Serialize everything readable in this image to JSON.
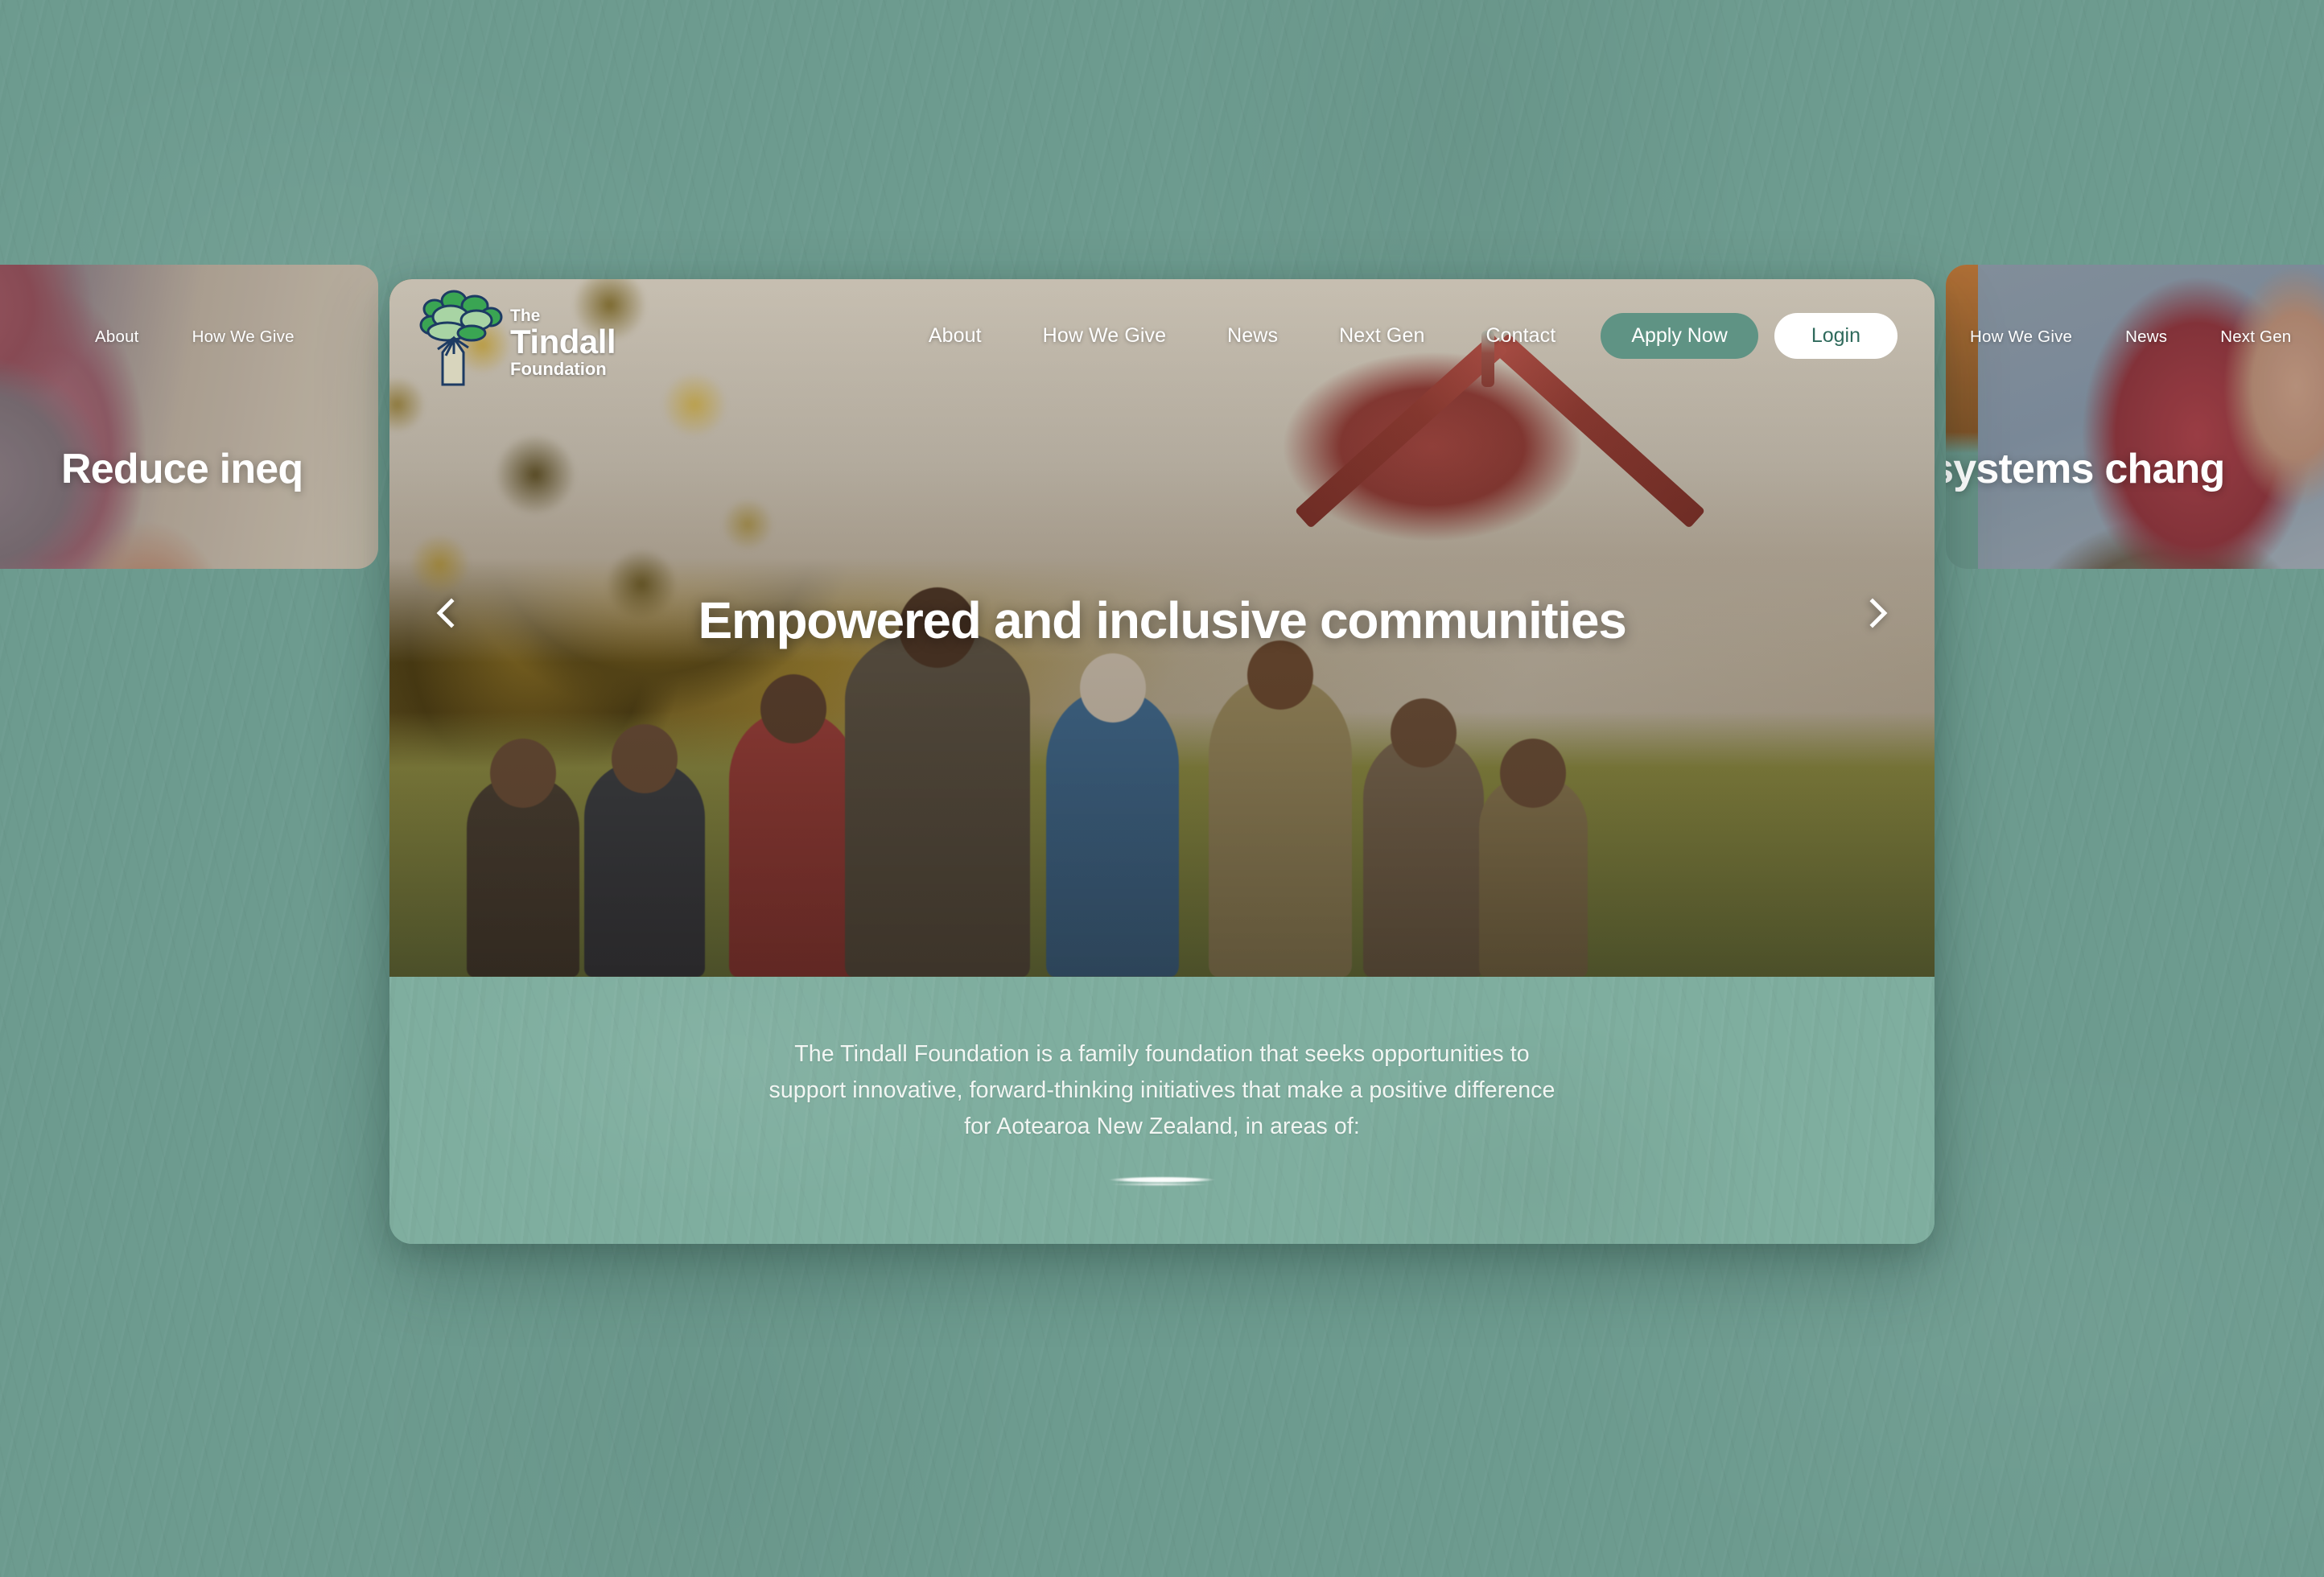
{
  "site": {
    "logo": {
      "line1": "The",
      "line2": "Tindall",
      "line3": "Foundation",
      "icon": "tree-logo-icon"
    },
    "accent_green": "#5f9384",
    "panel_green": "#7fae9f",
    "page_green": "#6d9b8f"
  },
  "nav": {
    "links": [
      {
        "label": "About"
      },
      {
        "label": "How We Give"
      },
      {
        "label": "News"
      },
      {
        "label": "Next Gen"
      },
      {
        "label": "Contact"
      }
    ],
    "apply_label": "Apply Now",
    "login_label": "Login"
  },
  "hero": {
    "title": "Empowered and inclusive communities",
    "prev_icon": "chevron-left-icon",
    "next_icon": "chevron-right-icon",
    "image_alt": "People sharing a meal outside a carved wharenui at a marae"
  },
  "panel": {
    "paragraph": "The Tindall Foundation is a family foundation that seeks opportunities to support innovative, forward-thinking initiatives that make a positive difference for Aotearoa New Zealand, in areas of:",
    "scroll_indicator": "brush-stroke-divider"
  },
  "side_cards": {
    "left": {
      "title": "Reduce ineq",
      "nav": [
        {
          "label": "About"
        },
        {
          "label": "How We Give"
        }
      ]
    },
    "right": {
      "title": "to systems chang",
      "nav": [
        {
          "label": "How We Give"
        },
        {
          "label": "News"
        },
        {
          "label": "Next Gen"
        }
      ]
    }
  }
}
